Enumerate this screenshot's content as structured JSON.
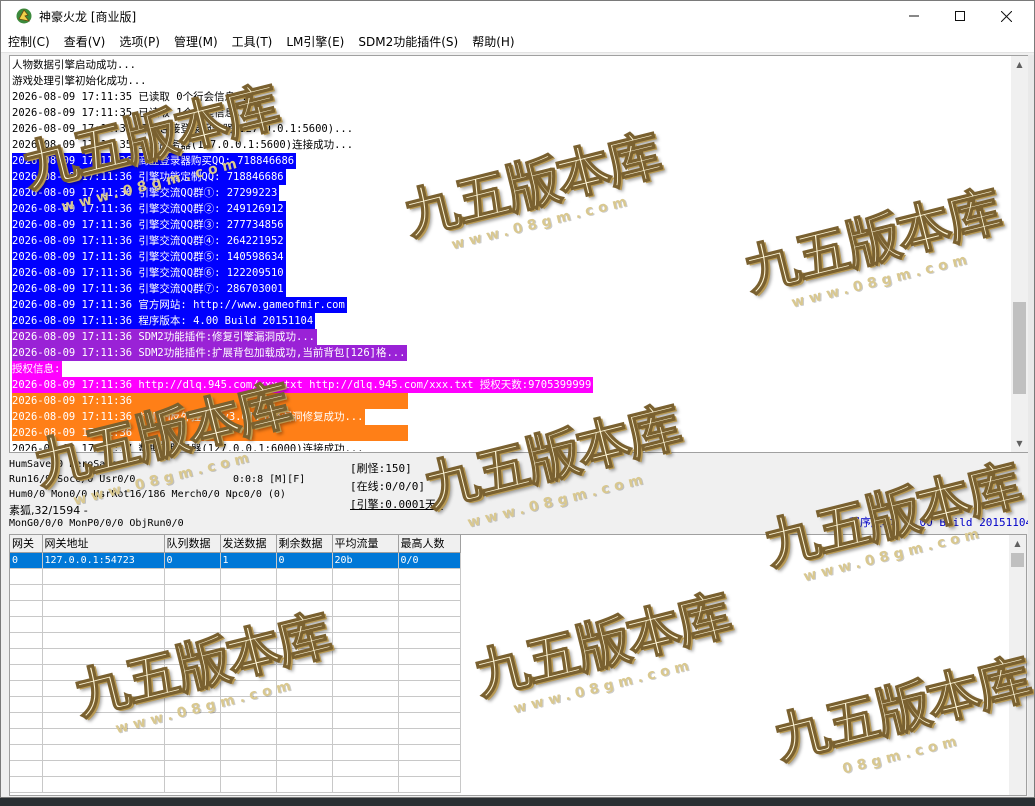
{
  "window": {
    "title": "神豪火龙 [商业版]"
  },
  "menu": [
    {
      "label": "控制(C)"
    },
    {
      "label": "查看(V)"
    },
    {
      "label": "选项(P)"
    },
    {
      "label": "管理(M)"
    },
    {
      "label": "工具(T)"
    },
    {
      "label": "LM引擎(E)"
    },
    {
      "label": "SDM2功能插件(S)"
    },
    {
      "label": "帮助(H)"
    }
  ],
  "log": [
    {
      "text": "人物数据引擎启动成功...",
      "style": ""
    },
    {
      "text": "游戏处理引擎初始化成功...",
      "style": ""
    },
    {
      "text": "2026-08-09 17:11:35 已读取 0个行会信息...",
      "style": ""
    },
    {
      "text": "2026-08-09 17:11:35 已读取 1个城堡信息...",
      "style": ""
    },
    {
      "text": "2026-08-09 17:11:35 开始连接登录服务器(127.0.0.1:5600)...",
      "style": ""
    },
    {
      "text": "2026-08-09 17:11:35 登录服务器(127.0.0.1:5600)连接成功...",
      "style": ""
    },
    {
      "text": "2026-08-09 17:11:36 商业登录器购买QQ: 718846686",
      "style": "bg-blue"
    },
    {
      "text": "2026-08-09 17:11:36 引擎功能定制QQ: 718846686",
      "style": "bg-blue"
    },
    {
      "text": "2026-08-09 17:11:36 引擎交流QQ群①: 27299223",
      "style": "bg-blue"
    },
    {
      "text": "2026-08-09 17:11:36 引擎交流QQ群②: 249126912",
      "style": "bg-blue"
    },
    {
      "text": "2026-08-09 17:11:36 引擎交流QQ群③: 277734856",
      "style": "bg-blue"
    },
    {
      "text": "2026-08-09 17:11:36 引擎交流QQ群④: 264221952",
      "style": "bg-blue"
    },
    {
      "text": "2026-08-09 17:11:36 引擎交流QQ群⑤: 140598634",
      "style": "bg-blue"
    },
    {
      "text": "2026-08-09 17:11:36 引擎交流QQ群⑥: 122209510",
      "style": "bg-blue"
    },
    {
      "text": "2026-08-09 17:11:36 引擎交流QQ群⑦: 286703001",
      "style": "bg-blue"
    },
    {
      "text": "2026-08-09 17:11:36 官方网站: http://www.gameofmir.com",
      "style": "bg-blue"
    },
    {
      "text": "2026-08-09 17:11:36 程序版本: 4.00 Build 20151104",
      "style": "bg-blue"
    },
    {
      "text": "2026-08-09 17:11:36 SDM2功能插件:修复引擎漏洞成功...",
      "style": "bg-purple"
    },
    {
      "text": "2026-08-09 17:11:36 SDM2功能插件:扩展背包加载成功,当前背包[126]格...",
      "style": "bg-purple"
    },
    {
      "text": "授权信息:",
      "style": "bg-magenta"
    },
    {
      "text": "2026-08-09 17:11:36 http://dlq.945.com/xxx.txt http://dlq.945.com/xxx.txt 授权天数:9705399999",
      "style": "bg-magenta"
    },
    {
      "text": "2026-08-09 17:11:36 ",
      "style": "bg-orange-full"
    },
    {
      "text": "2026-08-09 17:11:36 * [LM反外挂引擎v3.6]:引擎漏洞修复成功...",
      "style": "bg-orange"
    },
    {
      "text": "2026-08-09 17:11:36 ",
      "style": "bg-orange-full"
    },
    {
      "text": "2026-08-09 17:11:37 数据库服务器(127.0.0.1:6000)连接成功...",
      "style": ""
    }
  ],
  "status": {
    "line1": "HumSave:0 HeroSave:0",
    "line2a": "Run16/9 Soc0/0 Usr0/0",
    "line2b": "0:0:8 [M][F]",
    "line3": "Hum0/0 Mon0/0 UsrRot16/186 Merch0/0 Npc0/0 (0)",
    "line4": "素狐,32/1594 -",
    "line5": "MonG0/0/0 MonP0/0/0 ObjRun0/0",
    "refresh_monster": "[刷怪:150]",
    "online": "[在线:0/0/0]",
    "engine": "[引擎:0.0001天]",
    "version": "程序版本: 4.00 Build 20151104"
  },
  "grid": {
    "columns": [
      "网关",
      "网关地址",
      "队列数据",
      "发送数据",
      "剩余数据",
      "平均流量",
      "最高人数"
    ],
    "rows": [
      [
        "0",
        "127.0.0.1:54723",
        "0",
        "1",
        "0",
        "20b",
        "0/0"
      ]
    ]
  },
  "watermark": {
    "main": "九五版本库",
    "sub_a": "www.08gm.com",
    "sub_b": "08gm.com"
  },
  "colors": {
    "log_blue": "#0000ff",
    "log_purple": "#9a22d6",
    "log_magenta": "#ff00ff",
    "log_orange": "#ff7f17",
    "selection": "#0078d7",
    "version_text": "#0000c8"
  }
}
